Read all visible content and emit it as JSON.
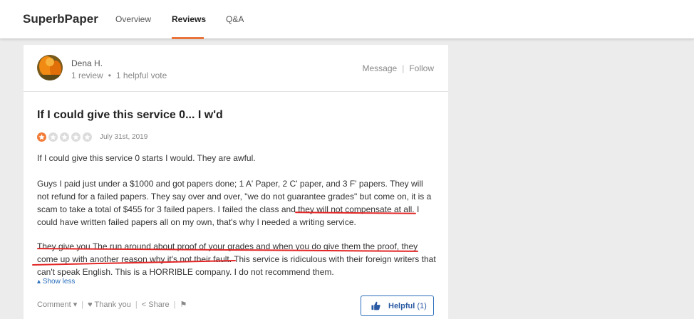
{
  "header": {
    "brand": "SuperbPaper",
    "tabs": [
      {
        "label": "Overview"
      },
      {
        "label": "Reviews"
      },
      {
        "label": "Q&A"
      }
    ]
  },
  "author": {
    "name": "Dena H.",
    "reviews": "1 review",
    "votes": "1 helpful vote",
    "message_label": "Message",
    "follow_label": "Follow"
  },
  "review": {
    "title": "If I could give this service 0... I w'd",
    "rating": 1,
    "rating_max": 5,
    "date": "July 31st, 2019",
    "paragraphs": [
      "If I could give this service 0 starts I would. They are awful.",
      "Guys I paid just under a $1000 and got papers done; 1 A' Paper, 2 C' paper, and 3 F' papers. They will not refund for a failed papers. They say over and over, \"we do not guarantee grades\" but come on, it is a scam to take a total of $455 for 3 failed papers. I failed the class and they will not compensate at all. I could have written failed papers all on my own, that's why I needed a writing service.",
      "They give you The run around about proof of your grades and when you do give them the proof, they come up with another reason why it's not their fault. This service is ridiculous with their foreign writers that can't speak English. This is a HORRIBLE company. I do not recommend them."
    ],
    "show_less_label": "Show less"
  },
  "actions": {
    "comment_label": "Comment",
    "thank_label": "Thank you",
    "share_label": "Share",
    "helpful_label": "Helpful",
    "helpful_count": "(1)"
  },
  "colors": {
    "accent": "#e8743b",
    "star_on": "#f27c38",
    "link": "#2a6ebb",
    "annotation": "#e32626"
  }
}
